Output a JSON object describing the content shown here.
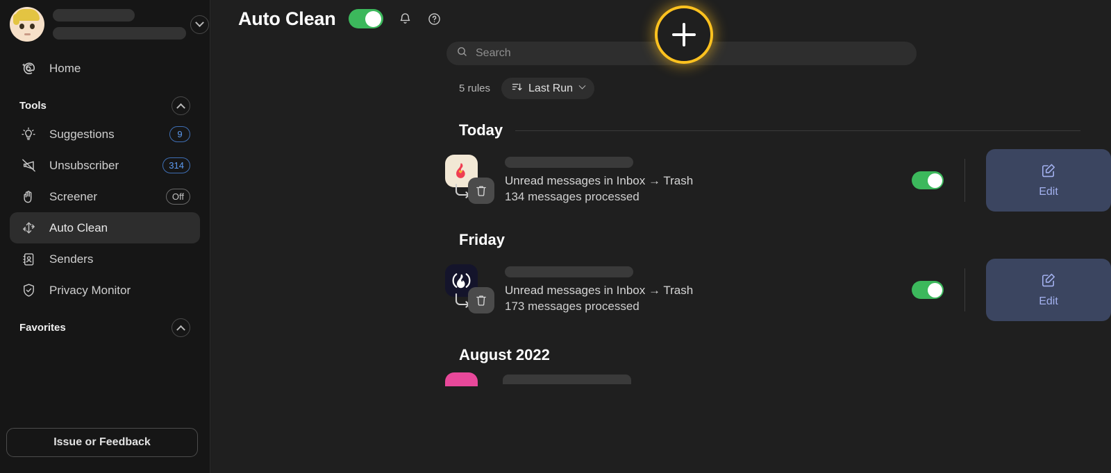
{
  "sidebar": {
    "account": {
      "avatar_name": "user-memoji-avatar",
      "expand_icon": "chevron-down-icon"
    },
    "home": {
      "label": "Home",
      "icon": "at-sparkle-icon"
    },
    "tools_section": {
      "label": "Tools",
      "collapse_icon": "chevron-up-icon"
    },
    "tools": [
      {
        "label": "Suggestions",
        "icon": "lightbulb-icon",
        "badge": "9",
        "badge_style": "blue",
        "active": false
      },
      {
        "label": "Unsubscriber",
        "icon": "megaphone-off-icon",
        "badge": "314",
        "badge_style": "blue",
        "active": false
      },
      {
        "label": "Screener",
        "icon": "hand-raised-icon",
        "badge": "Off",
        "badge_style": "grey",
        "active": false
      },
      {
        "label": "Auto Clean",
        "icon": "auto-clean-arrows-icon",
        "badge": "",
        "badge_style": "none",
        "active": true
      },
      {
        "label": "Senders",
        "icon": "contact-book-icon",
        "badge": "",
        "badge_style": "none",
        "active": false
      },
      {
        "label": "Privacy Monitor",
        "icon": "shield-check-icon",
        "badge": "",
        "badge_style": "none",
        "active": false
      }
    ],
    "favorites_section": {
      "label": "Favorites",
      "collapse_icon": "chevron-up-icon"
    },
    "feedback_button": {
      "label": "Issue or Feedback"
    }
  },
  "header": {
    "title": "Auto Clean",
    "master_toggle": {
      "state": "on",
      "color": "#3cb85c"
    },
    "notification_icon": "bell-icon",
    "help_icon": "question-circle-icon",
    "add_button": {
      "icon": "plus-icon",
      "highlight_color": "#ffc21f",
      "highlighted": true
    }
  },
  "search": {
    "placeholder": "Search",
    "value": "",
    "icon": "search-icon"
  },
  "meta": {
    "rules_count": "5 rules",
    "sort": {
      "label": "Last Run",
      "icon": "sort-descending-icon",
      "chevron": "chevron-down-icon"
    }
  },
  "groups": [
    {
      "title": "Today",
      "has_divider": true,
      "rules": [
        {
          "app_icon": "flame-heart-icon",
          "app_icon_bg": "#f2e8d5",
          "app_icon_glyph": "🔥",
          "action_icon": "trash-icon",
          "flow_icon": "curved-arrow-icon",
          "name_redacted": true,
          "description": "Unread messages in Inbox → Trash",
          "stats": "134 messages processed",
          "toggle": {
            "state": "on",
            "color": "#3cb85c"
          },
          "edit": {
            "label": "Edit",
            "icon": "pencil-square-icon",
            "bg": "#3b4560",
            "fg": "#a3b1ef"
          }
        }
      ]
    },
    {
      "title": "Friday",
      "has_divider": false,
      "rules": [
        {
          "app_icon": "flame-parentheses-icon",
          "app_icon_bg": "#14142b",
          "app_icon_glyph": "🔥",
          "action_icon": "trash-icon",
          "flow_icon": "curved-arrow-icon",
          "name_redacted": true,
          "description": "Unread messages in Inbox → Trash",
          "stats": "173 messages processed",
          "toggle": {
            "state": "on",
            "color": "#3cb85c"
          },
          "edit": {
            "label": "Edit",
            "icon": "pencil-square-icon",
            "bg": "#3b4560",
            "fg": "#a3b1ef"
          }
        }
      ]
    },
    {
      "title": "August 2022",
      "has_divider": false,
      "rules": []
    }
  ],
  "partial_row": {
    "app_icon_bg": "#e8489a",
    "name_redacted": true
  }
}
